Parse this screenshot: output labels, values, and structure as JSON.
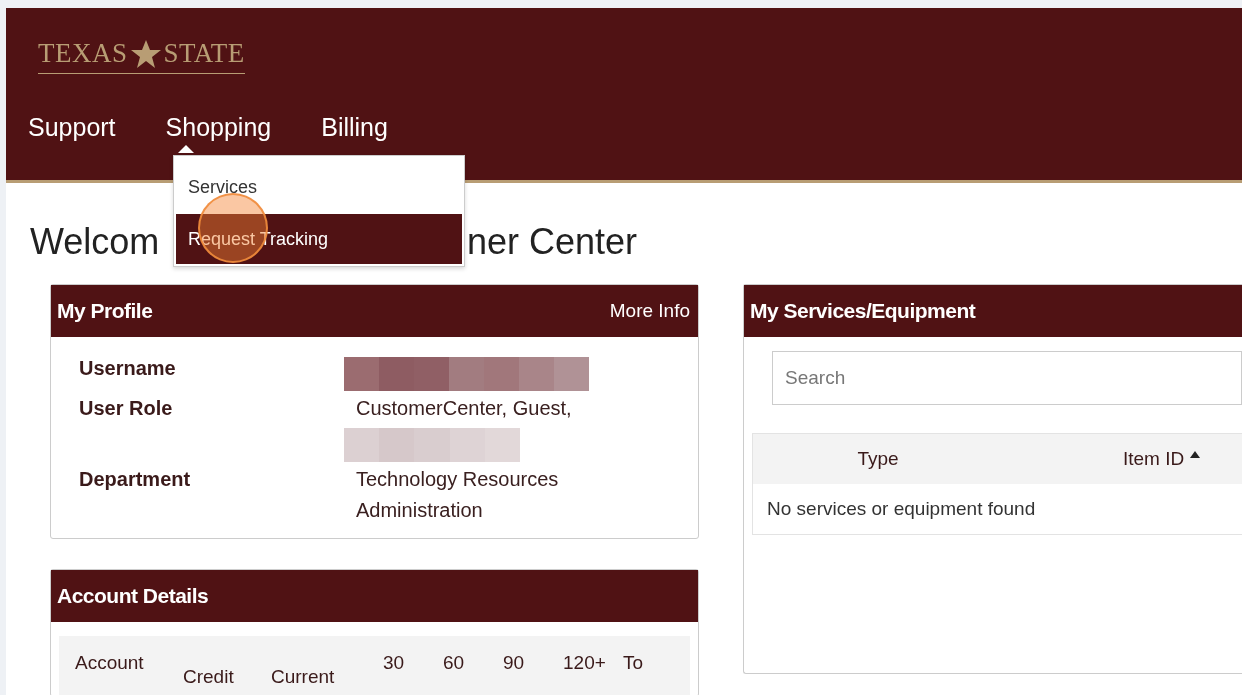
{
  "logo": {
    "left": "TEXAS",
    "right": "STATE"
  },
  "nav": [
    {
      "label": "Support",
      "expanded": false
    },
    {
      "label": "Shopping",
      "expanded": true
    },
    {
      "label": "Billing",
      "expanded": false
    }
  ],
  "dropdown": [
    {
      "label": "Services",
      "selected": false
    },
    {
      "label": "Request Tracking",
      "selected": true
    }
  ],
  "heading": {
    "visible_start": "Welcom",
    "visible_end": "ner Center"
  },
  "profile": {
    "title": "My Profile",
    "link": "More Info",
    "rows": [
      {
        "label": "Username",
        "values": [
          {
            "kind": "redacted-wide"
          }
        ]
      },
      {
        "label": "User Role",
        "values": [
          {
            "kind": "text",
            "text": "CustomerCenter, Guest,"
          },
          {
            "kind": "redacted-narrow"
          }
        ]
      },
      {
        "label": "Department",
        "values": [
          {
            "kind": "text",
            "text": "Technology Resources"
          },
          {
            "kind": "text",
            "text": "Administration"
          }
        ]
      }
    ]
  },
  "account": {
    "title": "Account Details",
    "columns": [
      {
        "label": "Account",
        "kind": "top"
      },
      {
        "label": "Credit",
        "kind": "low"
      },
      {
        "label": "Current",
        "kind": "low"
      },
      {
        "label": "30",
        "kind": "top"
      },
      {
        "label": "60",
        "kind": "top"
      },
      {
        "label": "90",
        "kind": "top"
      },
      {
        "label": "120+",
        "kind": "top"
      },
      {
        "label": "To",
        "kind": "top"
      }
    ]
  },
  "services": {
    "title": "My Services/Equipment",
    "search": {
      "placeholder": "Search"
    },
    "columns": [
      {
        "label": "Type",
        "sorted": false
      },
      {
        "label": "Item ID",
        "sorted": true
      }
    ],
    "empty": "No services or equipment found"
  }
}
